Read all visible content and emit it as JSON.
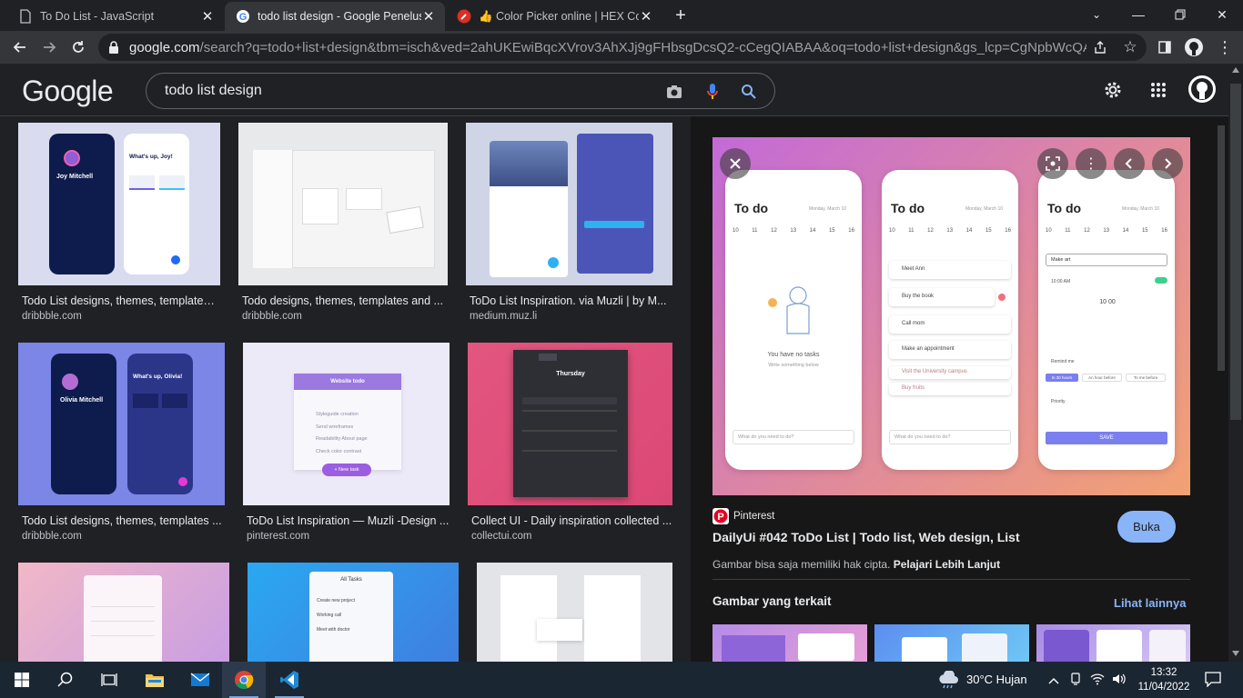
{
  "browser": {
    "tabs": [
      {
        "title": "To Do List - JavaScript",
        "icon": "document-icon",
        "active": false
      },
      {
        "title": "todo list design - Google Penelus",
        "icon": "google-g-icon",
        "active": true
      },
      {
        "title": "👍 Color Picker online | HEX Colo",
        "icon": "color-picker-icon",
        "active": false
      }
    ],
    "new_tab": "+",
    "url_host": "google.com",
    "url_rest": "/search?q=todo+list+design&tbm=isch&ved=2ahUKEwiBqcXVrov3AhXJj9gFHbsgDcsQ2-cCegQIABAA&oq=todo+list+design&gs_lcp=CgNpbWcQAzIFCAA..."
  },
  "google": {
    "logo": "Google",
    "query": "todo list design"
  },
  "results": [
    {
      "title": "Todo List designs, themes, templates ...",
      "source": "dribbble.com"
    },
    {
      "title": "Todo designs, themes, templates and ...",
      "source": "dribbble.com"
    },
    {
      "title": "ToDo List Inspiration. via Muzli | by M...",
      "source": "medium.muz.li"
    },
    {
      "title": "Todo List designs, themes, templates ...",
      "source": "dribbble.com"
    },
    {
      "title": "ToDo List Inspiration — Muzli -Design ...",
      "source": "pinterest.com"
    },
    {
      "title": "Collect UI - Daily inspiration collected ...",
      "source": "collectui.com"
    }
  ],
  "thumbs": {
    "joy_name": "Joy Mitchell",
    "joy_greet": "What's up, Joy!",
    "olivia_name": "Olivia Mitchell",
    "olivia_greet": "What's up, Olivia!",
    "website_todo": "Website todo",
    "web_items": [
      "Styleguide creation",
      "Send wireframes",
      "Readability About page",
      "Check color contrast"
    ],
    "new_task": "+ New task",
    "thursday": "Thursday",
    "all_tasks": "All Tasks",
    "task_items": [
      "Create new project",
      "Working call",
      "Meet with doctor"
    ]
  },
  "panel": {
    "source": "Pinterest",
    "title": "DailyUi #042 ToDo List | Todo list, Web design, List",
    "open_label": "Buka",
    "copyright": "Gambar bisa saja memiliki hak cipta.",
    "learn_more": "Pelajari Lebih Lanjut",
    "related": "Gambar yang terkait",
    "see_more": "Lihat lainnya",
    "preview": {
      "heading": "To do",
      "date": "Monday, March 10",
      "days": [
        "M",
        "T",
        "W",
        "T",
        "F",
        "S",
        "S"
      ],
      "nums": [
        "10",
        "11",
        "12",
        "13",
        "14",
        "15",
        "16"
      ],
      "empty_title": "You have no tasks",
      "empty_sub": "Write something below",
      "input_placeholder": "What do you need to do?",
      "tasks": [
        "Meet Ann",
        "Buy the book",
        "Call mom",
        "Make an appointment",
        "Visit the University campus",
        "Buy fruits"
      ],
      "new_task": "Make art",
      "time": "10:00 AM",
      "remind": "Remind me",
      "priority": "Priority",
      "save": "SAVE",
      "chips": [
        "In 30 hours",
        "An hour before",
        "To me before"
      ]
    }
  },
  "taskbar": {
    "weather": "30°C  Hujan",
    "time": "13:32",
    "date": "11/04/2022"
  },
  "colors": {
    "accent": "#8ab4f8",
    "background": "#202124",
    "panel": "#171717",
    "taskbar": "#1b2633"
  }
}
